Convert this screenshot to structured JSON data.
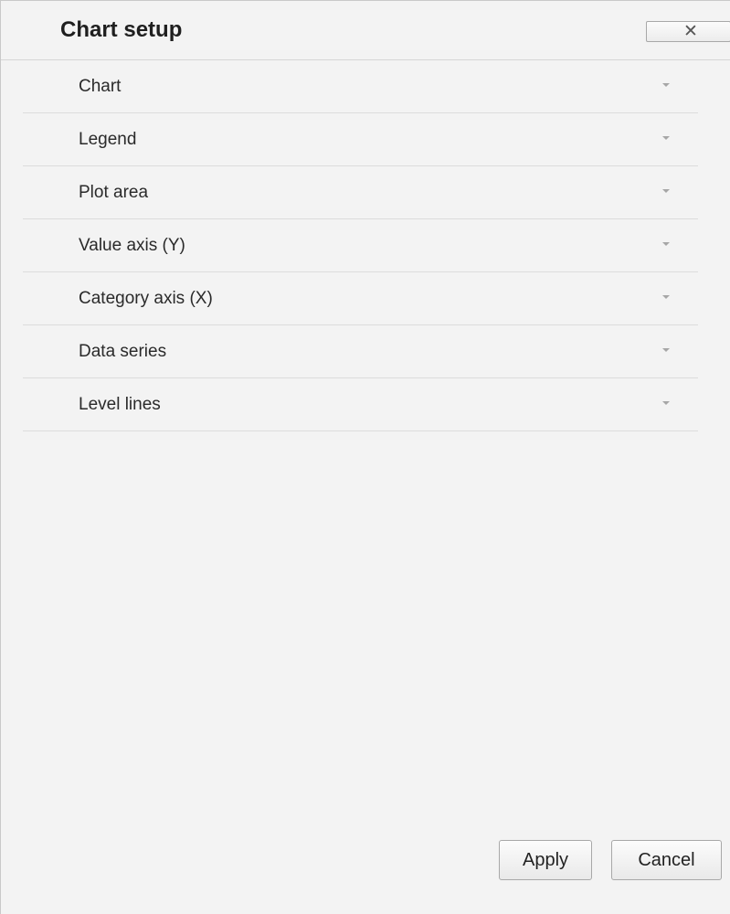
{
  "dialog": {
    "title": "Chart setup",
    "close_icon": "close-icon",
    "close_glyph": "✕"
  },
  "sections": [
    {
      "label": "Chart",
      "icon": "chevron-down-icon"
    },
    {
      "label": "Legend",
      "icon": "chevron-down-icon"
    },
    {
      "label": "Plot area",
      "icon": "chevron-down-icon"
    },
    {
      "label": "Value axis (Y)",
      "icon": "chevron-down-icon"
    },
    {
      "label": "Category axis (X)",
      "icon": "chevron-down-icon"
    },
    {
      "label": "Data series",
      "icon": "chevron-down-icon"
    },
    {
      "label": "Level lines",
      "icon": "chevron-down-icon"
    }
  ],
  "footer": {
    "apply_label": "Apply",
    "cancel_label": "Cancel"
  },
  "colors": {
    "background": "#f3f3f3",
    "divider": "#dcdcdc",
    "chevron": "#a6a6a6"
  }
}
